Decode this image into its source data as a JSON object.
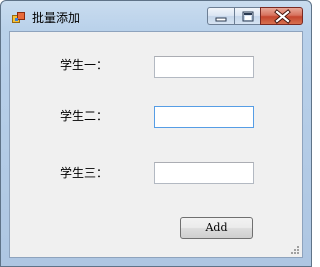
{
  "window": {
    "title": "批量添加",
    "icon": "app-icon"
  },
  "caption_buttons": {
    "minimize": "minimize-icon",
    "maximize": "maximize-icon",
    "close": "close-icon"
  },
  "form": {
    "fields": [
      {
        "label": "学生一：",
        "value": ""
      },
      {
        "label": "学生二：",
        "value": ""
      },
      {
        "label": "学生三：",
        "value": ""
      }
    ],
    "add_button": "Add"
  },
  "colors": {
    "title_bar": "#b9d1ea",
    "client_bg": "#f0f0f0",
    "close_button": "#c4462e",
    "focus_border": "#569de5"
  }
}
